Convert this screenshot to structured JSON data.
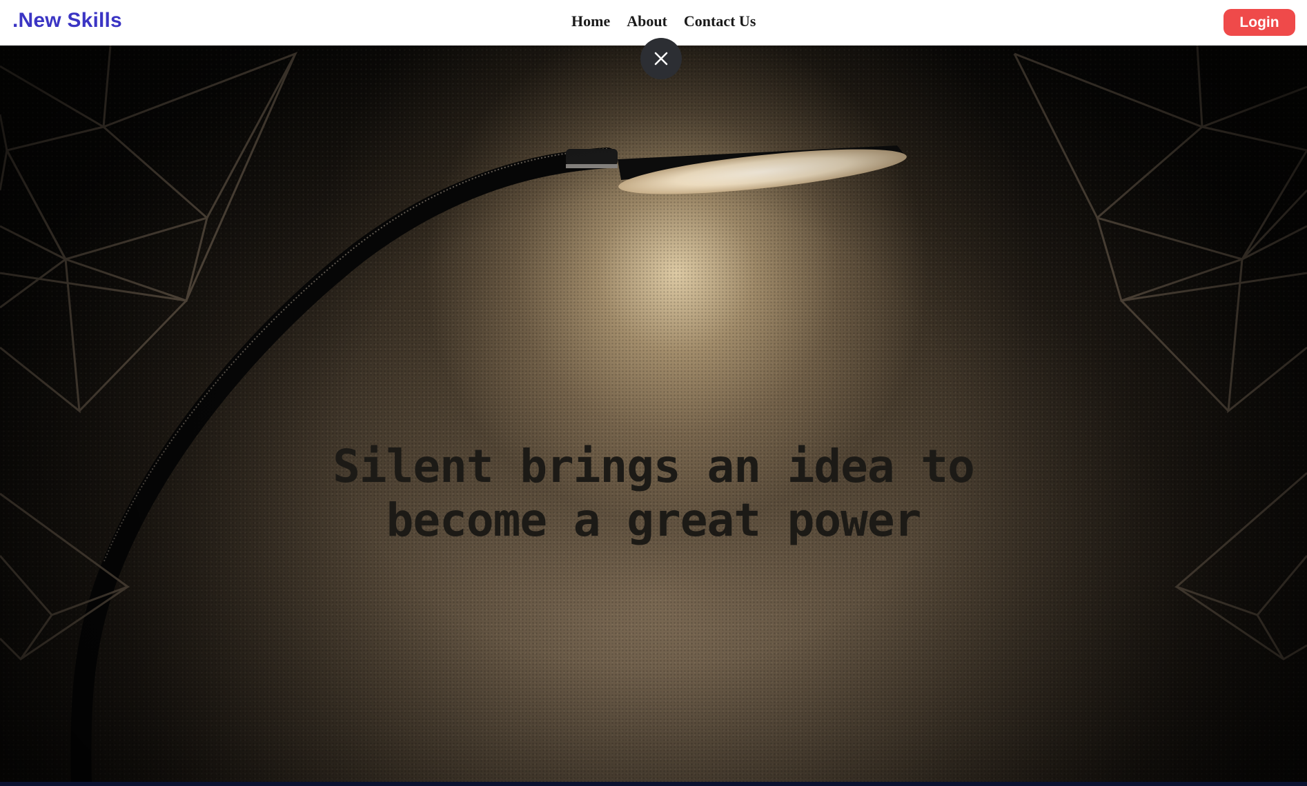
{
  "header": {
    "brand": ".New Skills",
    "nav": [
      {
        "label": "Home"
      },
      {
        "label": "About"
      },
      {
        "label": "Contact Us"
      }
    ],
    "login_label": "Login"
  },
  "hero": {
    "headline_line1": "Silent brings an idea to",
    "headline_line2": "become a great power"
  },
  "colors": {
    "brand": "#3b35c4",
    "login_button": "#ef4a4a",
    "close_button": "#2c2e33"
  },
  "icons": {
    "close": "close-icon",
    "lamp": "lamp-image"
  }
}
